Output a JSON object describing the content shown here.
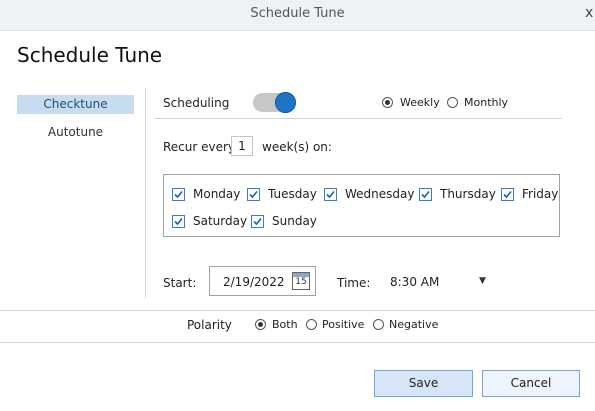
{
  "window": {
    "title": "Schedule Tune",
    "close_glyph": "x"
  },
  "header": {
    "title": "Schedule Tune"
  },
  "sidebar": {
    "items": [
      {
        "label": "Checktune"
      },
      {
        "label": "Autotune"
      }
    ]
  },
  "scheduling": {
    "label": "Scheduling",
    "enabled": true,
    "frequency_options": [
      {
        "label": "Weekly",
        "selected": true
      },
      {
        "label": "Monthly",
        "selected": false
      }
    ]
  },
  "recur": {
    "prefix": "Recur every",
    "value": "1",
    "suffix": "week(s) on:"
  },
  "days": [
    {
      "label": "Monday",
      "checked": true
    },
    {
      "label": "Tuesday",
      "checked": true
    },
    {
      "label": "Wednesday",
      "checked": true
    },
    {
      "label": "Thursday",
      "checked": true
    },
    {
      "label": "Friday",
      "checked": true
    },
    {
      "label": "Saturday",
      "checked": true
    },
    {
      "label": "Sunday",
      "checked": true
    }
  ],
  "start": {
    "label": "Start:",
    "value": "2/19/2022",
    "calendar_day": "15"
  },
  "time": {
    "label": "Time:",
    "value": "8:30 AM"
  },
  "polarity": {
    "label": "Polarity",
    "options": [
      {
        "label": "Both",
        "selected": true
      },
      {
        "label": "Positive",
        "selected": false
      },
      {
        "label": "Negative",
        "selected": false
      }
    ]
  },
  "buttons": {
    "save": "Save",
    "cancel": "Cancel"
  },
  "colors": {
    "accent": "#1e74c8",
    "sidebar_active": "#c8dcf0",
    "button_primary": "#d6e6f7"
  }
}
